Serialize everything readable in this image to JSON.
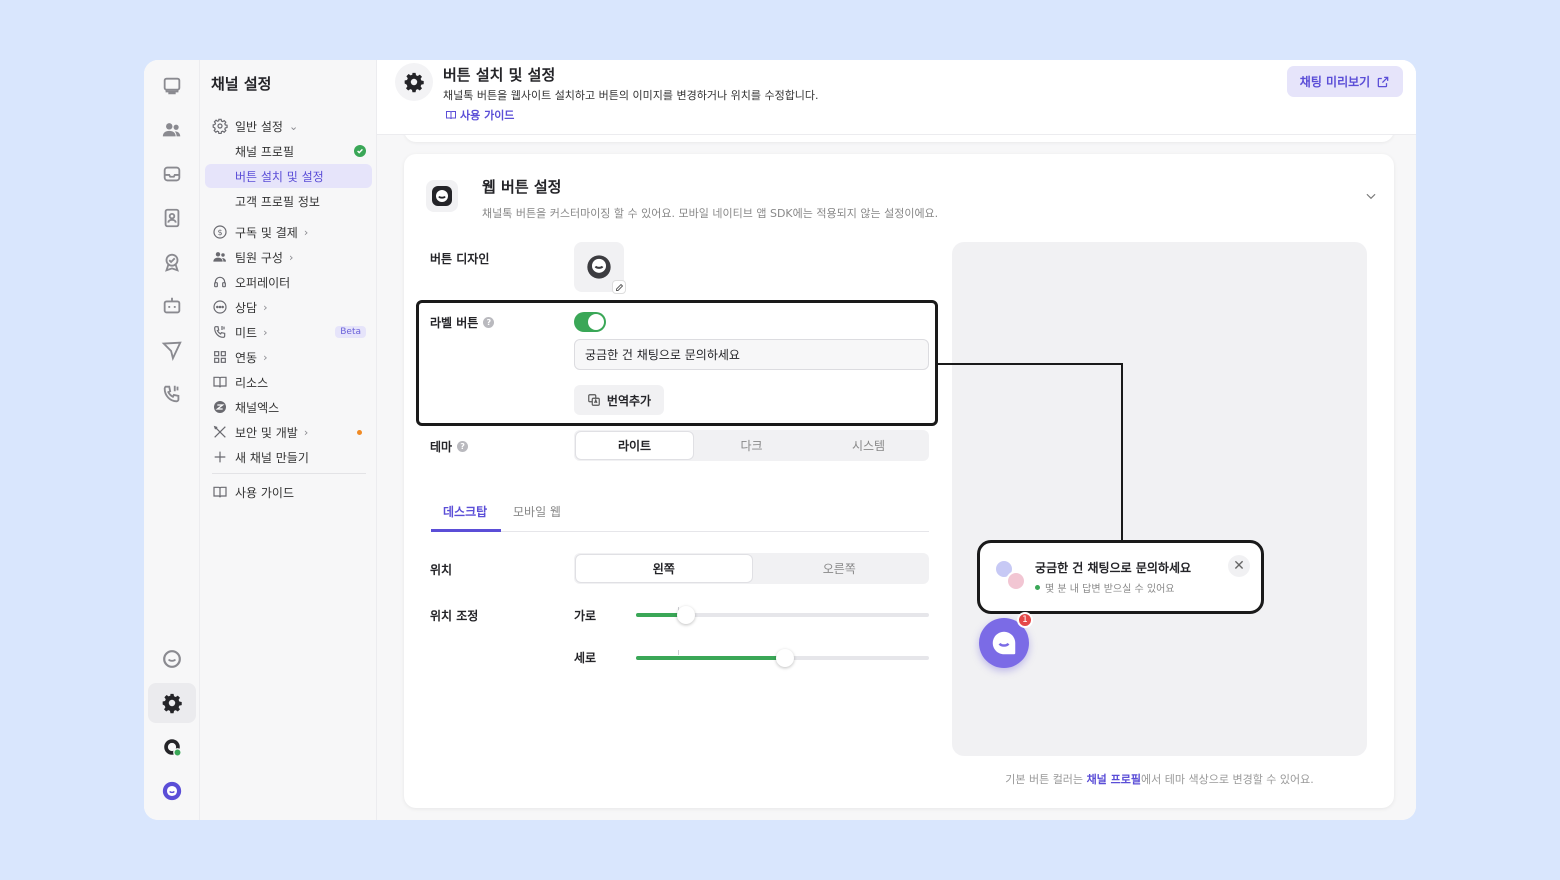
{
  "colors": {
    "accent": "#5b4ed7",
    "toggle_on": "#3aa757",
    "outline": "#1a1a1a",
    "background": "#d9e6fd"
  },
  "rail": {
    "icons": [
      "monitor-icon",
      "team-icon",
      "inbox-icon",
      "contact-icon",
      "approval-icon",
      "bot-icon",
      "send-icon",
      "phone-icon",
      "channel-talk-icon",
      "settings-icon",
      "status-icon",
      "brand-logo-icon"
    ]
  },
  "sidebar": {
    "title": "채널 설정",
    "items": [
      {
        "label": "일반 설정",
        "icon": "gear-icon",
        "expanded": true
      },
      {
        "label": "채널 프로필",
        "sub": true,
        "badge": "check"
      },
      {
        "label": "버튼 설치 및 설정",
        "sub": true,
        "selected": true
      },
      {
        "label": "고객 프로필 정보",
        "sub": true
      },
      {
        "label": "구독 및 결제",
        "icon": "dollar-icon"
      },
      {
        "label": "팀원 구성",
        "icon": "users-icon"
      },
      {
        "label": "오퍼레이터",
        "icon": "headset-icon"
      },
      {
        "label": "상담",
        "icon": "chat-icon"
      },
      {
        "label": "미트",
        "icon": "phone-icon",
        "badge": "Beta"
      },
      {
        "label": "연동",
        "icon": "grid-icon"
      },
      {
        "label": "리소스",
        "icon": "book-icon"
      },
      {
        "label": "채널엑스",
        "icon": "channelx-icon"
      },
      {
        "label": "보안 및 개발",
        "icon": "tools-icon"
      },
      {
        "label": "새 채널 만들기",
        "icon": "plus-icon"
      },
      {
        "label": "사용 가이드",
        "icon": "book-icon"
      }
    ]
  },
  "header": {
    "title": "버튼 설치 및 설정",
    "description": "채널톡 버튼을 웹사이트 설치하고 버튼의 이미지를 변경하거나 위치를 수정합니다.",
    "guide_link": "사용 가이드",
    "preview_button": "채팅 미리보기"
  },
  "card": {
    "title": "웹 버튼 설정",
    "description": "채널톡 버튼을 커스터마이징 할 수 있어요. 모바일 네이티브 앱 SDK에는 적용되지 않는 설정이에요.",
    "button_design_label": "버튼 디자인",
    "label_button": {
      "label": "라벨 버튼",
      "enabled": true,
      "text": "궁금한 건 채팅으로 문의하세요",
      "translate_button": "번역추가"
    },
    "theme": {
      "label": "테마",
      "options": [
        "라이트",
        "다크",
        "시스템"
      ],
      "selected": "라이트"
    },
    "tabs": {
      "items": [
        "데스크탑",
        "모바일 웹"
      ],
      "selected": "데스크탑"
    },
    "position": {
      "label": "위치",
      "options": [
        "왼쪽",
        "오른쪽"
      ],
      "selected": "왼쪽"
    },
    "position_adjust": {
      "label": "위치 조정",
      "horizontal": {
        "label": "가로",
        "value": 0.17
      },
      "vertical": {
        "label": "세로",
        "value": 0.51
      }
    },
    "footnote": {
      "before": "기본 버튼 컬러는 ",
      "link": "채널 프로필",
      "after": "에서 테마 색상으로 변경할 수 있어요."
    }
  },
  "preview": {
    "bubble_title": "궁금한 건 채팅으로 문의하세요",
    "bubble_subtitle": "몇 분 내 답변 받으실 수 있어요",
    "badge_count": "1"
  }
}
